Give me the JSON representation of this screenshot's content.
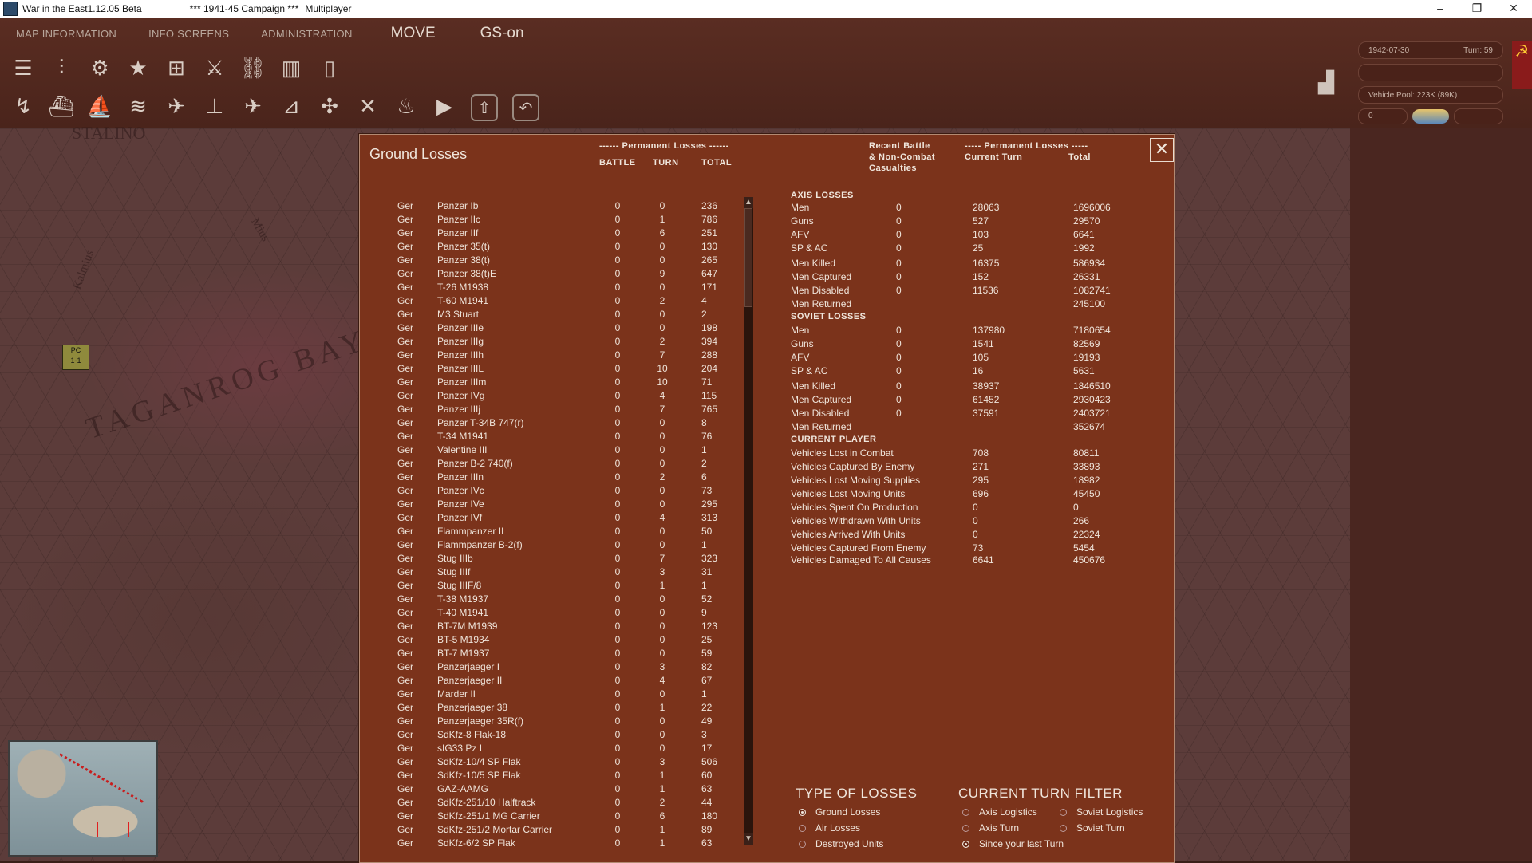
{
  "window": {
    "title": "War in the East1.12.05 Beta",
    "campaign": "***   1941-45 Campaign   ***",
    "mode": "Multiplayer",
    "controls": [
      "–",
      "❐",
      "✕"
    ]
  },
  "menu": {
    "items": [
      "MAP INFORMATION",
      "INFO SCREENS",
      "ADMINISTRATION"
    ],
    "mode": "MOVE",
    "gs": "GS-on"
  },
  "status": {
    "date": "1942-07-30",
    "turn": "Turn: 59",
    "vehicle_pool": "Vehicle Pool: 223K (89K)",
    "counter": "0"
  },
  "map": {
    "labels": [
      "STALINO",
      "TAGANROG BAY",
      "Kalmius",
      "Mius"
    ],
    "unit": {
      "type": "PC",
      "strength": "1-1"
    }
  },
  "dialog": {
    "title": "Ground Losses",
    "close": "✕",
    "perm_header": "------ Permanent Losses ------",
    "col_battle": "BATTLE",
    "col_turn": "TURN",
    "col_total": "TOTAL",
    "recent_1": "Recent Battle",
    "recent_2": "& Non-Combat",
    "recent_3": "Casualties",
    "perm_header2": "----- Permanent Losses -----",
    "col_current": "Current Turn",
    "col_total2": "Total",
    "rows": [
      {
        "nat": "Ger",
        "name": "Panzer Ib",
        "battle": "0",
        "turn": "0",
        "total": "236"
      },
      {
        "nat": "Ger",
        "name": "Panzer IIc",
        "battle": "0",
        "turn": "1",
        "total": "786"
      },
      {
        "nat": "Ger",
        "name": "Panzer IIf",
        "battle": "0",
        "turn": "6",
        "total": "251"
      },
      {
        "nat": "Ger",
        "name": "Panzer 35(t)",
        "battle": "0",
        "turn": "0",
        "total": "130"
      },
      {
        "nat": "Ger",
        "name": "Panzer 38(t)",
        "battle": "0",
        "turn": "0",
        "total": "265"
      },
      {
        "nat": "Ger",
        "name": "Panzer 38(t)E",
        "battle": "0",
        "turn": "9",
        "total": "647"
      },
      {
        "nat": "Ger",
        "name": "T-26 M1938",
        "battle": "0",
        "turn": "0",
        "total": "171"
      },
      {
        "nat": "Ger",
        "name": "T-60 M1941",
        "battle": "0",
        "turn": "2",
        "total": "4"
      },
      {
        "nat": "Ger",
        "name": "M3 Stuart",
        "battle": "0",
        "turn": "0",
        "total": "2"
      },
      {
        "nat": "Ger",
        "name": "Panzer IIIe",
        "battle": "0",
        "turn": "0",
        "total": "198"
      },
      {
        "nat": "Ger",
        "name": "Panzer IIIg",
        "battle": "0",
        "turn": "2",
        "total": "394"
      },
      {
        "nat": "Ger",
        "name": "Panzer IIIh",
        "battle": "0",
        "turn": "7",
        "total": "288"
      },
      {
        "nat": "Ger",
        "name": "Panzer IIIL",
        "battle": "0",
        "turn": "10",
        "total": "204"
      },
      {
        "nat": "Ger",
        "name": "Panzer IIIm",
        "battle": "0",
        "turn": "10",
        "total": "71"
      },
      {
        "nat": "Ger",
        "name": "Panzer IVg",
        "battle": "0",
        "turn": "4",
        "total": "115"
      },
      {
        "nat": "Ger",
        "name": "Panzer IIIj",
        "battle": "0",
        "turn": "7",
        "total": "765"
      },
      {
        "nat": "Ger",
        "name": "Panzer T-34B 747(r)",
        "battle": "0",
        "turn": "0",
        "total": "8"
      },
      {
        "nat": "Ger",
        "name": "T-34 M1941",
        "battle": "0",
        "turn": "0",
        "total": "76"
      },
      {
        "nat": "Ger",
        "name": "Valentine III",
        "battle": "0",
        "turn": "0",
        "total": "1"
      },
      {
        "nat": "Ger",
        "name": "Panzer B-2 740(f)",
        "battle": "0",
        "turn": "0",
        "total": "2"
      },
      {
        "nat": "Ger",
        "name": "Panzer IIIn",
        "battle": "0",
        "turn": "2",
        "total": "6"
      },
      {
        "nat": "Ger",
        "name": "Panzer IVc",
        "battle": "0",
        "turn": "0",
        "total": "73"
      },
      {
        "nat": "Ger",
        "name": "Panzer IVe",
        "battle": "0",
        "turn": "0",
        "total": "295"
      },
      {
        "nat": "Ger",
        "name": "Panzer IVf",
        "battle": "0",
        "turn": "4",
        "total": "313"
      },
      {
        "nat": "Ger",
        "name": "Flammpanzer II",
        "battle": "0",
        "turn": "0",
        "total": "50"
      },
      {
        "nat": "Ger",
        "name": "Flammpanzer B-2(f)",
        "battle": "0",
        "turn": "0",
        "total": "1"
      },
      {
        "nat": "Ger",
        "name": "Stug IIIb",
        "battle": "0",
        "turn": "7",
        "total": "323"
      },
      {
        "nat": "Ger",
        "name": "Stug IIIf",
        "battle": "0",
        "turn": "3",
        "total": "31"
      },
      {
        "nat": "Ger",
        "name": "Stug IIIF/8",
        "battle": "0",
        "turn": "1",
        "total": "1"
      },
      {
        "nat": "Ger",
        "name": "T-38 M1937",
        "battle": "0",
        "turn": "0",
        "total": "52"
      },
      {
        "nat": "Ger",
        "name": "T-40 M1941",
        "battle": "0",
        "turn": "0",
        "total": "9"
      },
      {
        "nat": "Ger",
        "name": "BT-7M M1939",
        "battle": "0",
        "turn": "0",
        "total": "123"
      },
      {
        "nat": "Ger",
        "name": "BT-5 M1934",
        "battle": "0",
        "turn": "0",
        "total": "25"
      },
      {
        "nat": "Ger",
        "name": "BT-7 M1937",
        "battle": "0",
        "turn": "0",
        "total": "59"
      },
      {
        "nat": "Ger",
        "name": "Panzerjaeger I",
        "battle": "0",
        "turn": "3",
        "total": "82"
      },
      {
        "nat": "Ger",
        "name": "Panzerjaeger II",
        "battle": "0",
        "turn": "4",
        "total": "67"
      },
      {
        "nat": "Ger",
        "name": "Marder II",
        "battle": "0",
        "turn": "0",
        "total": "1"
      },
      {
        "nat": "Ger",
        "name": "Panzerjaeger 38",
        "battle": "0",
        "turn": "1",
        "total": "22"
      },
      {
        "nat": "Ger",
        "name": "Panzerjaeger 35R(f)",
        "battle": "0",
        "turn": "0",
        "total": "49"
      },
      {
        "nat": "Ger",
        "name": "SdKfz-8 Flak-18",
        "battle": "0",
        "turn": "0",
        "total": "3"
      },
      {
        "nat": "Ger",
        "name": "sIG33 Pz I",
        "battle": "0",
        "turn": "0",
        "total": "17"
      },
      {
        "nat": "Ger",
        "name": "SdKfz-10/4 SP Flak",
        "battle": "0",
        "turn": "3",
        "total": "506"
      },
      {
        "nat": "Ger",
        "name": "SdKfz-10/5 SP Flak",
        "battle": "0",
        "turn": "1",
        "total": "60"
      },
      {
        "nat": "Ger",
        "name": "GAZ-AAMG",
        "battle": "0",
        "turn": "1",
        "total": "63"
      },
      {
        "nat": "Ger",
        "name": "SdKfz-251/10 Halftrack",
        "battle": "0",
        "turn": "2",
        "total": "44"
      },
      {
        "nat": "Ger",
        "name": "SdKfz-251/1 MG Carrier",
        "battle": "0",
        "turn": "6",
        "total": "180"
      },
      {
        "nat": "Ger",
        "name": "SdKfz-251/2 Mortar Carrier",
        "battle": "0",
        "turn": "1",
        "total": "89"
      },
      {
        "nat": "Ger",
        "name": "SdKfz-6/2 SP Flak",
        "battle": "0",
        "turn": "1",
        "total": "63"
      }
    ],
    "scroll_up": "▲",
    "scroll_down": "▼",
    "axis": {
      "heading": "AXIS LOSSES",
      "rows": [
        {
          "label": "Men",
          "recent": "0",
          "current": "28063",
          "total": "1696006"
        },
        {
          "label": "Guns",
          "recent": "0",
          "current": "527",
          "total": "29570"
        },
        {
          "label": "AFV",
          "recent": "0",
          "current": "103",
          "total": "6641"
        },
        {
          "label": "SP & AC",
          "recent": "0",
          "current": "25",
          "total": "1992"
        }
      ],
      "rows2": [
        {
          "label": "Men Killed",
          "recent": "0",
          "current": "16375",
          "total": "586934"
        },
        {
          "label": "Men Captured",
          "recent": "0",
          "current": "152",
          "total": "26331"
        },
        {
          "label": "Men Disabled",
          "recent": "0",
          "current": "11536",
          "total": "1082741"
        },
        {
          "label": "Men Returned",
          "recent": "",
          "current": "",
          "total": "245100"
        }
      ]
    },
    "soviet": {
      "heading": "SOVIET LOSSES",
      "rows": [
        {
          "label": "Men",
          "recent": "0",
          "current": "137980",
          "total": "7180654"
        },
        {
          "label": "Guns",
          "recent": "0",
          "current": "1541",
          "total": "82569"
        },
        {
          "label": "AFV",
          "recent": "0",
          "current": "105",
          "total": "19193"
        },
        {
          "label": "SP & AC",
          "recent": "0",
          "current": "16",
          "total": "5631"
        }
      ],
      "rows2": [
        {
          "label": "Men Killed",
          "recent": "0",
          "current": "38937",
          "total": "1846510"
        },
        {
          "label": "Men Captured",
          "recent": "0",
          "current": "61452",
          "total": "2930423"
        },
        {
          "label": "Men Disabled",
          "recent": "0",
          "current": "37591",
          "total": "2403721"
        },
        {
          "label": "Men Returned",
          "recent": "",
          "current": "",
          "total": "352674"
        }
      ]
    },
    "player": {
      "heading": "CURRENT PLAYER",
      "rows": [
        {
          "label": "Vehicles Lost in Combat",
          "current": "708",
          "total": "80811"
        },
        {
          "label": "Vehicles Captured By Enemy",
          "current": "271",
          "total": "33893"
        },
        {
          "label": "Vehicles Lost Moving Supplies",
          "current": "295",
          "total": "18982"
        },
        {
          "label": "Vehicles Lost Moving Units",
          "current": "696",
          "total": "45450"
        },
        {
          "label": "Vehicles Spent On Production",
          "current": "0",
          "total": "0"
        },
        {
          "label": "Vehicles Withdrawn With Units",
          "current": "0",
          "total": "266"
        },
        {
          "label": "Vehicles Arrived With Units",
          "current": "0",
          "total": "22324"
        },
        {
          "label": "Vehicles Captured From Enemy",
          "current": "73",
          "total": "5454"
        }
      ],
      "damaged": {
        "label": "Vehicles Damaged To All Causes",
        "current": "6641",
        "total": "450676"
      }
    },
    "type_of_losses": {
      "heading": "TYPE OF LOSSES",
      "options": [
        "Ground Losses",
        "Air Losses",
        "Destroyed Units"
      ],
      "selected": "Ground Losses"
    },
    "turn_filter": {
      "heading": "CURRENT TURN FILTER",
      "options": [
        "Axis Logistics",
        "Soviet Logistics",
        "Axis Turn",
        "Soviet Turn",
        "Since your last Turn"
      ],
      "selected": "Since your last Turn"
    }
  }
}
